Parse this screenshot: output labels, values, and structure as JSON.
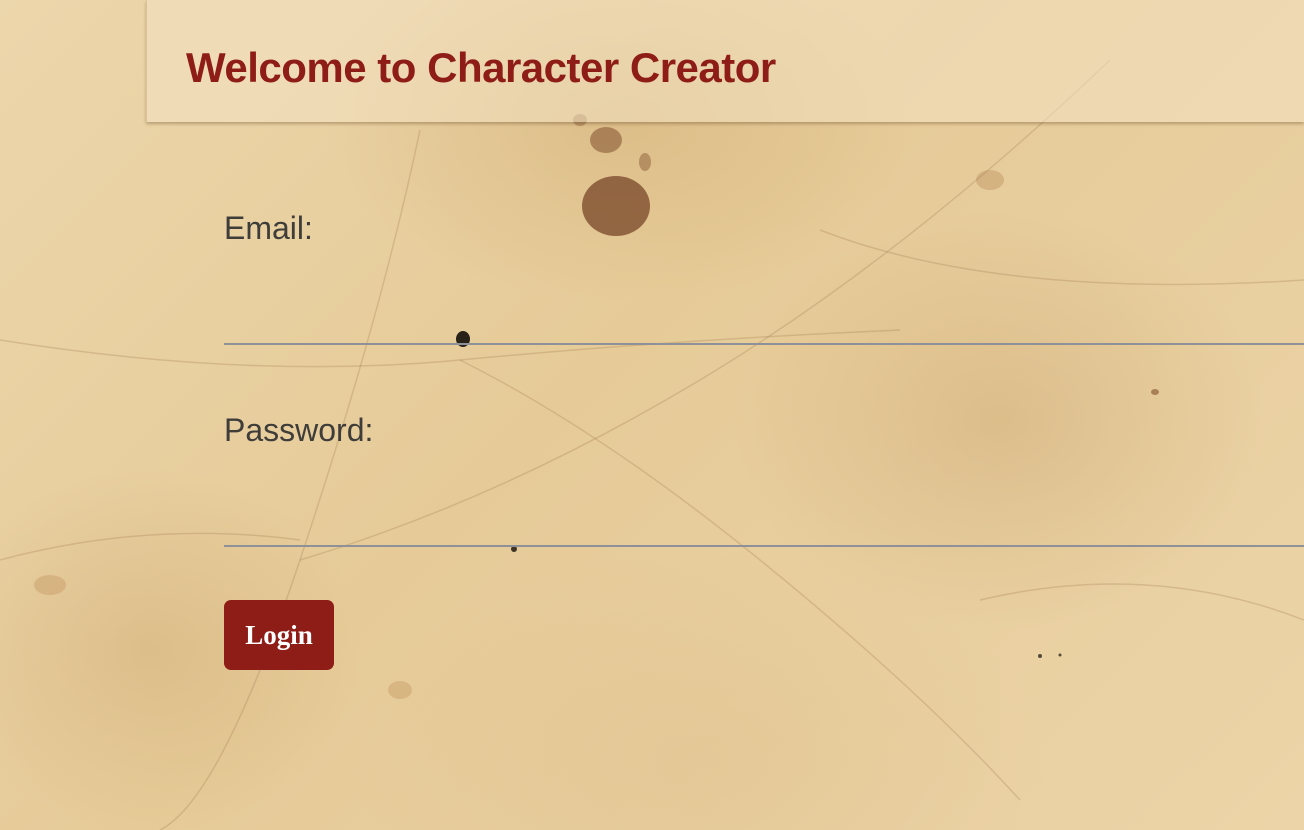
{
  "header": {
    "title": "Welcome to Character Creator"
  },
  "form": {
    "email": {
      "label": "Email:",
      "value": "",
      "placeholder": ""
    },
    "password": {
      "label": "Password:",
      "value": "",
      "placeholder": ""
    },
    "login_label": "Login"
  },
  "colors": {
    "accent": "#8f1d17",
    "label_text": "#3f3d3a",
    "input_underline": "#8e9298",
    "background": "#e9d2a6"
  }
}
